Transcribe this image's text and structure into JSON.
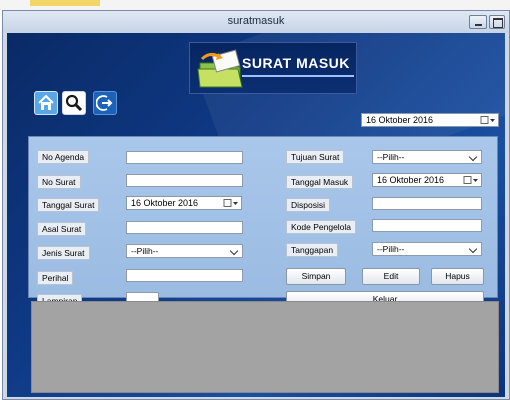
{
  "window": {
    "title": "suratmasuk"
  },
  "logo": {
    "text": "SURAT MASUK"
  },
  "header_date": {
    "value": "16  Oktober  2016"
  },
  "form": {
    "no_agenda": {
      "label": "No Agenda",
      "value": ""
    },
    "no_surat": {
      "label": "No Surat",
      "value": ""
    },
    "tanggal_surat": {
      "label": "Tanggal Surat",
      "value": "16  Oktober  2016"
    },
    "asal_surat": {
      "label": "Asal Surat",
      "value": ""
    },
    "jenis_surat": {
      "label": "Jenis Surat",
      "value": "--Pilih--"
    },
    "perihal": {
      "label": "Perihal",
      "value": ""
    },
    "lampiran": {
      "label": "Lampiran",
      "value": ""
    },
    "tujuan_surat": {
      "label": "Tujuan Surat",
      "value": "--Pilih--"
    },
    "tanggal_masuk": {
      "label": "Tanggal Masuk",
      "value": "16  Oktober  2016"
    },
    "disposisi": {
      "label": "Disposisi",
      "value": ""
    },
    "kode_pengelola": {
      "label": "Kode Pengelola",
      "value": ""
    },
    "tanggapan": {
      "label": "Tanggapan",
      "value": "--Pilih--"
    }
  },
  "buttons": {
    "simpan": "Simpan",
    "edit": "Edit",
    "hapus": "Hapus",
    "keluar": "Keluar"
  },
  "icons": {
    "home": "home-icon",
    "search": "search-icon",
    "exit": "exit-icon",
    "calendar": "calendar-dropdown-icon",
    "folder": "folder-mail-icon"
  },
  "colors": {
    "background": "#0f3a86",
    "panel": "#a9c7ea",
    "lower_panel": "#a3a3a3"
  }
}
